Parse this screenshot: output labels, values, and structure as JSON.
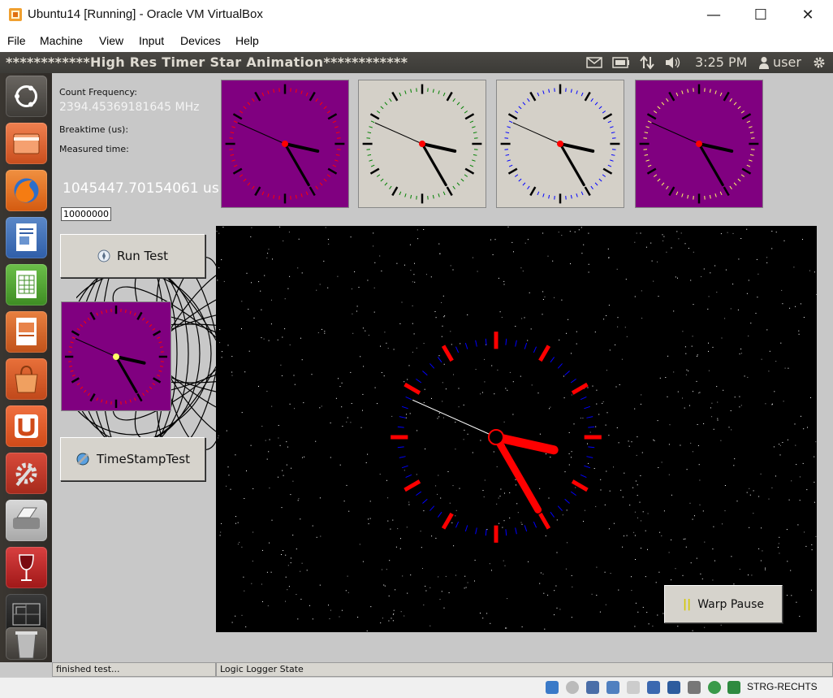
{
  "window": {
    "title": "Ubuntu14 [Running] - Oracle VM VirtualBox",
    "minimize_glyph": "—",
    "maximize_glyph": "☐",
    "close_glyph": "✕"
  },
  "menubar": {
    "items": [
      "File",
      "Machine",
      "View",
      "Input",
      "Devices",
      "Help"
    ]
  },
  "ubuntu_panel": {
    "title": "************High Res Timer Star Animation************",
    "time": "3:25 PM",
    "user": "user",
    "icons": [
      "mail-icon",
      "battery-icon",
      "network-icon",
      "volume-icon",
      "gear-icon"
    ]
  },
  "launcher": {
    "items": [
      "ubuntu-dash-icon",
      "files-icon",
      "firefox-icon",
      "writer-icon",
      "calc-icon",
      "impress-icon",
      "software-center-icon",
      "ubuntu-one-icon",
      "system-settings-icon",
      "scanner-icon",
      "wine-icon",
      "workspace-switcher-icon",
      "trash-icon"
    ]
  },
  "app": {
    "count_frequency_label": "Count Frequency:",
    "count_frequency_value": "2394.45369181645 MHz",
    "breaktime_label": "Breaktime (us):",
    "measured_time_label": "Measured time:",
    "measured_value": "1045447.70154061 us",
    "iterations_input": "10000000",
    "run_test_label": "Run Test",
    "timestamp_test_label": "TimeStampTest",
    "warp_pause_label": "Warp Pause",
    "status_left": "finished test...",
    "status_right": "Logic Logger State"
  },
  "clock_time": {
    "hour": 3,
    "minute": 25,
    "second": 49
  },
  "colors": {
    "purple_face": "#800080",
    "gray_face": "#d4d0c8",
    "red": "#ff0000",
    "green": "#008000",
    "blue": "#0000ff",
    "yellow": "#ffff66",
    "star_bg": "#000000"
  },
  "host_status": {
    "keyboard": "STRG-RECHTS"
  }
}
